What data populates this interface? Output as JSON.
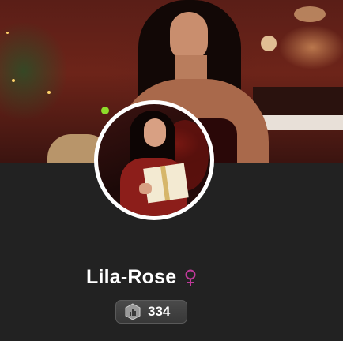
{
  "profile": {
    "name": "Lila-Rose",
    "gender_icon": "female-symbol-icon",
    "online_status": "online",
    "status_color": "#8fdc2a",
    "gender_color": "#c0399a"
  },
  "badge": {
    "icon": "hexagon-level-icon",
    "count": "334"
  }
}
